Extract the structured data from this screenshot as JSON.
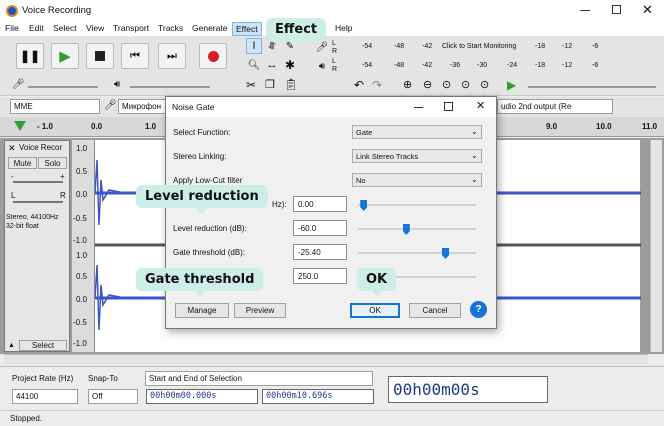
{
  "window": {
    "title": "Voice Recording"
  },
  "menu": [
    "File",
    "Edit",
    "Select",
    "View",
    "Transport",
    "Tracks",
    "Generate",
    "Effect",
    "Help"
  ],
  "meters": {
    "record_hint": "Click to Start Monitoring",
    "scale_top": [
      "-54",
      "-48",
      "-42",
      "-18",
      "-12",
      "-6"
    ],
    "scale_bottom": [
      "-54",
      "-48",
      "-42",
      "-36",
      "-30",
      "-24",
      "-18",
      "-12",
      "-6"
    ]
  },
  "devices": {
    "host": "MME",
    "input": "Микрофон",
    "output": "udio 2nd output (Re"
  },
  "ruler": {
    "ticks": [
      "- 1.0",
      "0.0",
      "1.0",
      "9.0",
      "10.0",
      "11.0"
    ]
  },
  "track": {
    "name": "Voice Recor",
    "mute": "Mute",
    "solo": "Solo",
    "info": "Stereo, 44100Hz\n32-bit float",
    "select": "Select",
    "gain_minus": "-",
    "gain_plus": "+",
    "pan_l": "L",
    "pan_r": "R",
    "scale": [
      "1.0",
      "0.5",
      "0.0",
      "-0.5",
      "-1.0",
      "1.0",
      "0.5",
      "0.0",
      "-0.5",
      "-1.0"
    ]
  },
  "dialog": {
    "title": "Noise Gate",
    "select_function_label": "Select Function:",
    "select_function_value": "Gate",
    "stereo_linking_label": "Stereo Linking:",
    "stereo_linking_value": "Link Stereo Tracks",
    "low_cut_label": "Apply Low-Cut filter",
    "low_cut_value": "No",
    "hz_label": "Hz):",
    "hz_value": "0.00",
    "level_reduction_label": "Level reduction (dB):",
    "level_reduction_value": "-60.0",
    "gate_threshold_label": "Gate threshold (dB):",
    "gate_threshold_value": "-25.40",
    "attack_value": "250.0",
    "manage": "Manage",
    "preview": "Preview",
    "ok": "OK",
    "cancel": "Cancel",
    "help": "?",
    "sliders": {
      "hz": 0.02,
      "level_reduction": 0.4,
      "gate_threshold": 0.75,
      "attack": 0.0
    }
  },
  "callouts": {
    "effect": "Effect",
    "level_reduction": "Level reduction",
    "gate_threshold": "Gate threshold",
    "ok": "OK"
  },
  "bottom": {
    "project_rate_label": "Project Rate (Hz)",
    "project_rate_value": "44100",
    "snap_label": "Snap-To",
    "snap_value": "Off",
    "selection_label": "Start and End of Selection",
    "start": "00h00m00.000s",
    "end": "00h00m10.696s",
    "big_time": "00h00m00s"
  },
  "status": {
    "text": "Stopped."
  },
  "colors": {
    "accent": "#1673d8",
    "wave": "#3a56c8",
    "callout": "#cdeee6",
    "play": "#2ea02e",
    "record": "#d42020"
  }
}
